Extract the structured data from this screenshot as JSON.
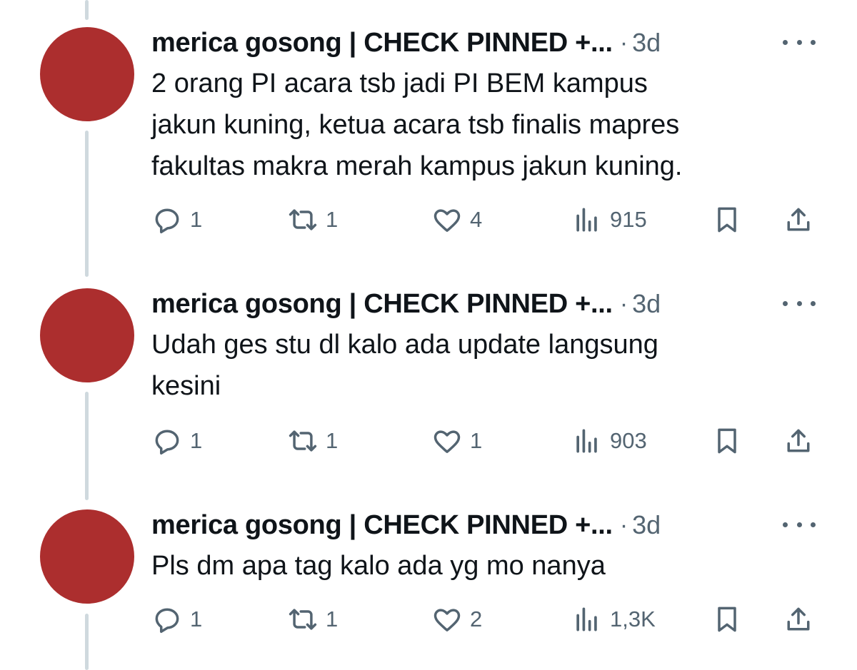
{
  "tweets": [
    {
      "name": "merica gosong | CHECK PINNED +...",
      "separator": "·",
      "time": "3d",
      "lines": [
        "2 orang PI acara tsb jadi PI BEM kampus",
        "jakun kuning, ketua acara tsb finalis mapres",
        "fakultas makra merah kampus jakun kuning."
      ],
      "replies": "1",
      "reposts": "1",
      "likes": "4",
      "views": "915"
    },
    {
      "name": "merica gosong | CHECK PINNED +...",
      "separator": "·",
      "time": "3d",
      "lines": [
        "Udah ges stu dl kalo ada update langsung",
        "kesini"
      ],
      "replies": "1",
      "reposts": "1",
      "likes": "1",
      "views": "903"
    },
    {
      "name": "merica gosong | CHECK PINNED +...",
      "separator": "·",
      "time": "3d",
      "lines": [
        "Pls dm apa tag kalo ada yg mo nanya"
      ],
      "replies": "1",
      "reposts": "1",
      "likes": "2",
      "views": "1,3K"
    }
  ],
  "icons": {
    "reply": "speech-bubble",
    "repost": "repost-arrows",
    "like": "heart",
    "views": "bar-chart",
    "bookmark": "bookmark",
    "share": "share-upload"
  },
  "colors": {
    "avatar": "#ac2e2e",
    "secondary": "#536471",
    "thread_line": "#cfd9de"
  }
}
